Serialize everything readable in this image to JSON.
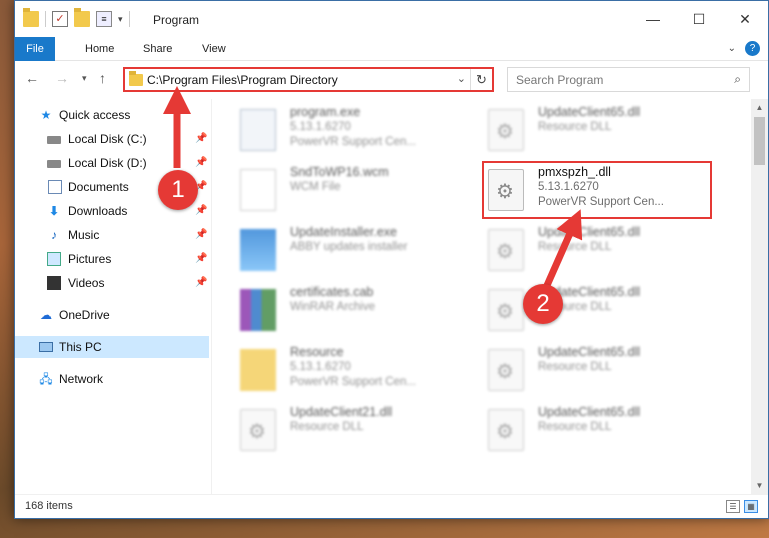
{
  "window": {
    "title": "Program",
    "controls": {
      "minimize": "—",
      "maximize": "☐",
      "close": "✕"
    }
  },
  "ribbon": {
    "tabs": [
      "File",
      "Home",
      "Share",
      "View"
    ],
    "help": "?"
  },
  "nav": {
    "address": "C:\\Program Files\\Program Directory",
    "search_placeholder": "Search Program"
  },
  "sidebar": {
    "items": [
      {
        "label": "Quick access",
        "icon": "star-icon"
      },
      {
        "label": "Local Disk (C:)",
        "icon": "disk-icon",
        "pinned": true
      },
      {
        "label": "Local Disk (D:)",
        "icon": "disk-icon",
        "pinned": true
      },
      {
        "label": "Documents",
        "icon": "documents-icon",
        "pinned": true
      },
      {
        "label": "Downloads",
        "icon": "download-icon",
        "pinned": true
      },
      {
        "label": "Music",
        "icon": "music-icon",
        "pinned": true
      },
      {
        "label": "Pictures",
        "icon": "pictures-icon",
        "pinned": true
      },
      {
        "label": "Videos",
        "icon": "videos-icon",
        "pinned": true
      },
      {
        "label": "OneDrive",
        "icon": "cloud-icon"
      },
      {
        "label": "This PC",
        "icon": "pc-icon",
        "selected": true
      },
      {
        "label": "Network",
        "icon": "network-icon"
      }
    ]
  },
  "files": {
    "left": [
      {
        "name": "program.exe",
        "line2": "5.13.1.6270",
        "line3": "PowerVR Support Cen...",
        "icon": "exe-icon"
      },
      {
        "name": "SndToWP16.wcm",
        "line2": "WCM File",
        "line3": "",
        "icon": "wcm-icon"
      },
      {
        "name": "UpdateInstaller.exe",
        "line2": "ABBY updates installer",
        "line3": "",
        "icon": "installer-icon"
      },
      {
        "name": "certificates.cab",
        "line2": "WinRAR Archive",
        "line3": "",
        "icon": "archive-icon"
      },
      {
        "name": "Resource",
        "line2": "5.13.1.6270",
        "line3": "PowerVR Support Cen...",
        "icon": "folder-icon"
      },
      {
        "name": "UpdateClient21.dll",
        "line2": "Resource DLL",
        "line3": "",
        "icon": "dll-icon"
      }
    ],
    "right": [
      {
        "name": "UpdateClient65.dll",
        "line2": "Resource DLL",
        "line3": "",
        "icon": "dll-icon"
      },
      {
        "name": "pmxspzh_.dll",
        "line2": "5.13.1.6270",
        "line3": "PowerVR Support Cen...",
        "icon": "dll-icon",
        "highlight": true
      },
      {
        "name": "UpdateClient65.dll",
        "line2": "Resource DLL",
        "line3": "",
        "icon": "dll-icon"
      },
      {
        "name": "UpdateClient65.dll",
        "line2": "Resource DLL",
        "line3": "",
        "icon": "dll-icon"
      },
      {
        "name": "UpdateClient65.dll",
        "line2": "Resource DLL",
        "line3": "",
        "icon": "dll-icon"
      },
      {
        "name": "UpdateClient65.dll",
        "line2": "Resource DLL",
        "line3": "",
        "icon": "dll-icon"
      }
    ]
  },
  "status": {
    "items_count": "168 items"
  },
  "annotations": {
    "badge1": "1",
    "badge2": "2",
    "color": "#e53935"
  }
}
